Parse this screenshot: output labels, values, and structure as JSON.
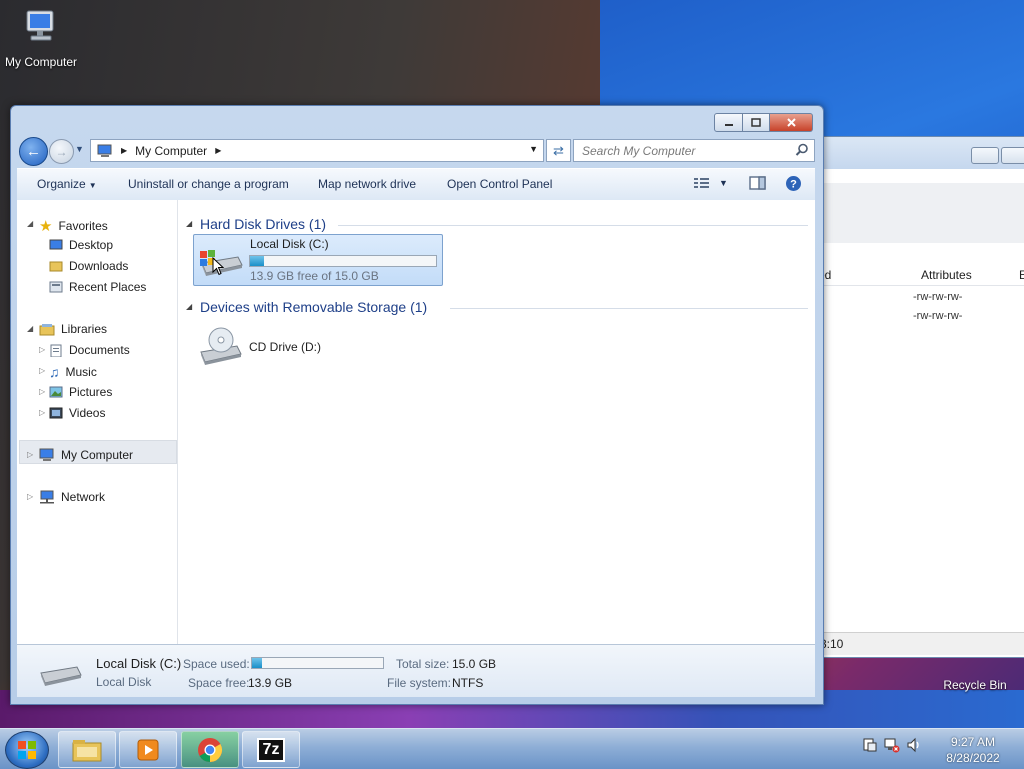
{
  "desktop": {
    "icons": [
      {
        "label": "My Computer",
        "icon": "computer-icon"
      },
      {
        "label": "Recycle Bin",
        "icon": "recycle-bin-icon"
      }
    ]
  },
  "background_window": {
    "col_partial": "ed",
    "col_attributes": "Attributes",
    "col_next": "E",
    "rows": [
      "-rw-rw-rw-",
      "-rw-rw-rw-"
    ],
    "status_partial": "3:10"
  },
  "window": {
    "controls": {
      "minimize": "minimize",
      "maximize": "maximize",
      "close": "close"
    },
    "address": {
      "crumb": "My Computer"
    },
    "search": {
      "placeholder": "Search My Computer"
    },
    "toolbar": {
      "organize": "Organize",
      "uninstall": "Uninstall or change a program",
      "map_drive": "Map network drive",
      "control_panel": "Open Control Panel"
    },
    "navpane": {
      "favorites": "Favorites",
      "favorites_items": [
        "Desktop",
        "Downloads",
        "Recent Places"
      ],
      "libraries": "Libraries",
      "libraries_items": [
        "Documents",
        "Music",
        "Pictures",
        "Videos"
      ],
      "computer": "My Computer",
      "network": "Network"
    },
    "groups": {
      "hdd": "Hard Disk Drives (1)",
      "removable": "Devices with Removable Storage (1)"
    },
    "drives": {
      "c": {
        "name": "Local Disk (C:)",
        "free_text": "13.9 GB free of 15.0 GB",
        "used_fraction": 0.073
      },
      "d": {
        "name": "CD Drive (D:)"
      }
    },
    "details": {
      "name": "Local Disk (C:)",
      "type": "Local Disk",
      "space_used_label": "Space used:",
      "space_free_label": "Space free:",
      "space_free": "13.9 GB",
      "total_size_label": "Total size:",
      "total_size": "15.0 GB",
      "fs_label": "File system:",
      "fs": "NTFS",
      "used_fraction": 0.073
    }
  },
  "taskbar": {
    "apps": [
      "windows-explorer-icon",
      "media-player-icon",
      "chrome-icon",
      "7zip-icon"
    ],
    "app_7z_label": "7z",
    "clock_time": "9:27 AM",
    "clock_date": "8/28/2022"
  },
  "colors": {
    "accent": "#1e3f88",
    "selection": "#c3dcf8",
    "bar_fill": "#1a8fc8"
  }
}
